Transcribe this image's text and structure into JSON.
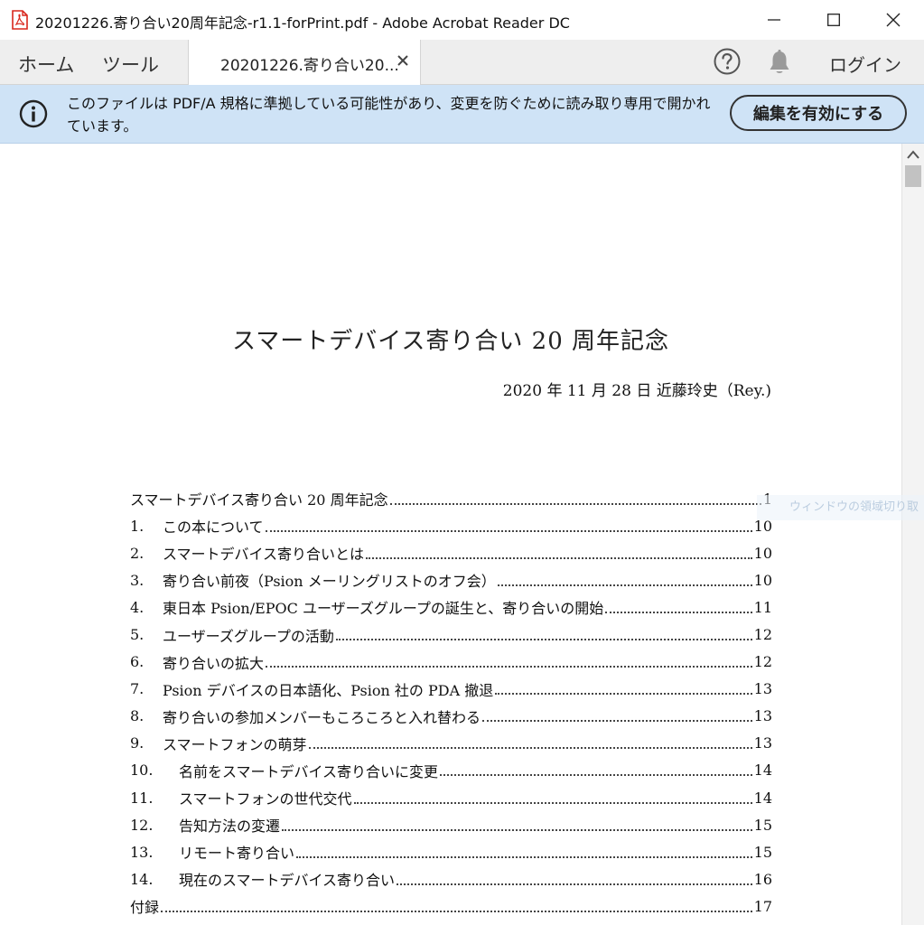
{
  "window": {
    "title": "20201226.寄り合い20周年記念-r1.1-forPrint.pdf - Adobe Acrobat Reader DC"
  },
  "nav": {
    "home": "ホーム",
    "tools": "ツール",
    "doc_tab": "20201226.寄り合い20...",
    "login": "ログイン"
  },
  "banner": {
    "message": "このファイルは PDF/A 規格に準拠している可能性があり、変更を防ぐために読み取り専用で開かれています。",
    "enable_edit": "編集を有効にする"
  },
  "document": {
    "title": "スマートデバイス寄り合い 20 周年記念",
    "author_line": "2020 年 11 月 28 日  近藤玲史（Rey.)",
    "toc": [
      {
        "num": "",
        "text": "スマートデバイス寄り合い 20 周年記念",
        "page": "1"
      },
      {
        "num": "1.",
        "text": "この本について",
        "page": "10"
      },
      {
        "num": "2.",
        "text": "スマートデバイス寄り合いとは",
        "page": "10"
      },
      {
        "num": "3.",
        "text": "寄り合い前夜（Psion メーリングリストのオフ会）",
        "page": "10"
      },
      {
        "num": "4.",
        "text": "東日本 Psion/EPOC ユーザーズグループの誕生と、寄り合いの開始",
        "page": "11"
      },
      {
        "num": "5.",
        "text": "ユーザーズグループの活動",
        "page": "12"
      },
      {
        "num": "6.",
        "text": "寄り合いの拡大",
        "page": "12"
      },
      {
        "num": "7.",
        "text": "Psion デバイスの日本語化、Psion 社の PDA 撤退",
        "page": "13"
      },
      {
        "num": "8.",
        "text": "寄り合いの参加メンバーもころころと入れ替わる",
        "page": "13"
      },
      {
        "num": "9.",
        "text": "スマートフォンの萌芽",
        "page": "13"
      },
      {
        "num": "10.",
        "text": "名前をスマートデバイス寄り合いに変更",
        "page": "14"
      },
      {
        "num": "11.",
        "text": "スマートフォンの世代交代",
        "page": "14"
      },
      {
        "num": "12.",
        "text": "告知方法の変遷",
        "page": "15"
      },
      {
        "num": "13.",
        "text": "リモート寄り合い",
        "page": "15"
      },
      {
        "num": "14.",
        "text": "現在のスマートデバイス寄り合い",
        "page": "16"
      },
      {
        "num": "",
        "text": "付録",
        "page": "17"
      }
    ]
  },
  "overlay": {
    "tooltip": "ウィンドウの領域切り取"
  },
  "colors": {
    "banner_bg": "#cfe3f6",
    "tabbar_bg": "#eeeeee",
    "pdf_icon_red": "#d9261c"
  }
}
